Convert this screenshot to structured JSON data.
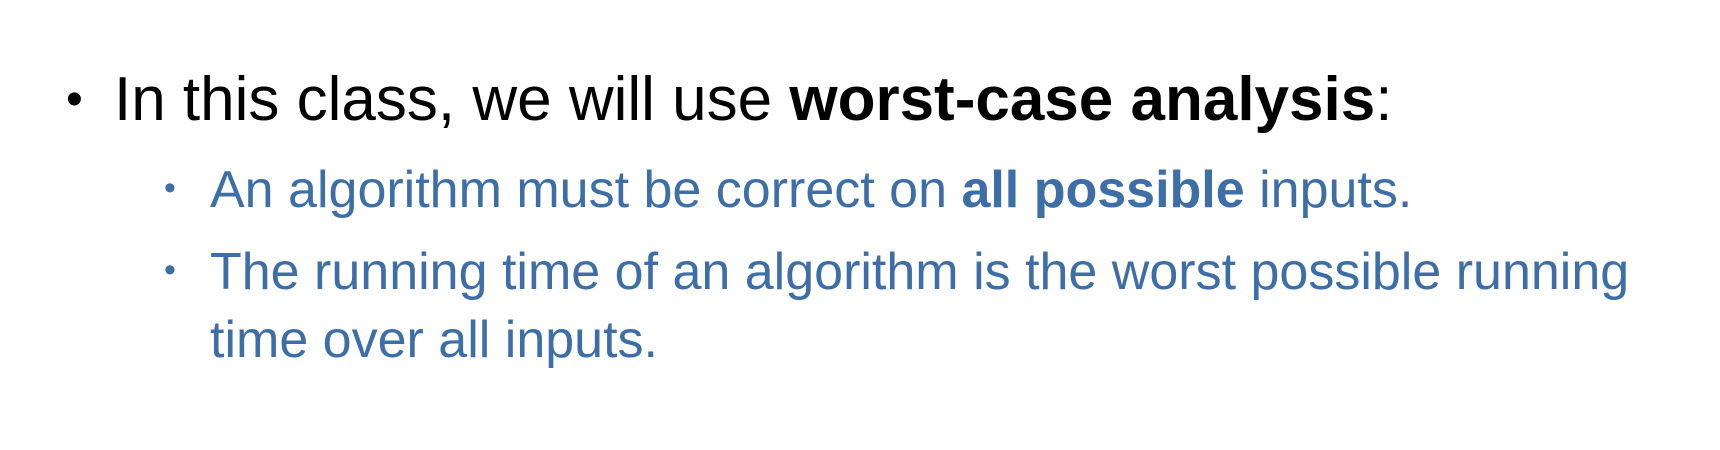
{
  "colors": {
    "primary_text": "#000000",
    "sub_text": "#3d6ea8"
  },
  "bullets": {
    "main": {
      "marker": "•",
      "prefix": "In this class, we will use ",
      "bold": "worst-case analysis",
      "suffix": ":"
    },
    "sub1": {
      "marker": "•",
      "prefix": "An algorithm must be correct on ",
      "bold": "all possible",
      "suffix": " inputs."
    },
    "sub2": {
      "marker": "•",
      "text": "The running time of an algorithm is the worst possible running time over all inputs."
    }
  }
}
